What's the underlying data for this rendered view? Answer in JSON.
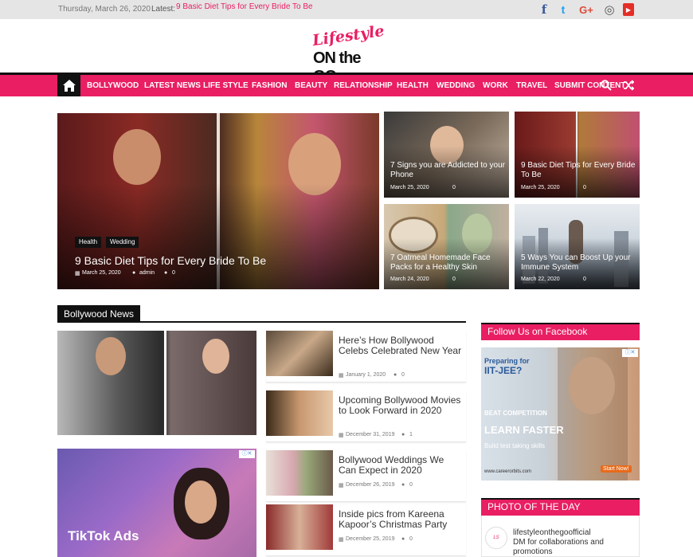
{
  "topbar": {
    "date": "Thursday, March 26, 2020",
    "latest_label": "Latest:",
    "latest_link": "9 Basic Diet Tips for Every Bride To Be"
  },
  "social": [
    {
      "name": "facebook-icon",
      "glyph": "f",
      "color": "#3b5998"
    },
    {
      "name": "twitter-icon",
      "glyph": "t",
      "color": "#1da1f2"
    },
    {
      "name": "google-plus-icon",
      "glyph": "G+",
      "color": "#dd4b39"
    },
    {
      "name": "instagram-icon",
      "glyph": "◎",
      "color": "#555555"
    },
    {
      "name": "youtube-icon",
      "glyph": "▶",
      "color": "#e52d27"
    }
  ],
  "logo": {
    "line1": "Lifestyle",
    "line2": "ON the GO"
  },
  "nav": {
    "items": [
      "BOLLYWOOD",
      "LATEST NEWS",
      "LIFE STYLE",
      "FASHION",
      "BEAUTY",
      "RELATIONSHIP",
      "HEALTH",
      "WEDDING",
      "WORK",
      "TRAVEL",
      "SUBMIT CONTENT"
    ]
  },
  "featured": {
    "tags": [
      "Health",
      "Wedding"
    ],
    "title": "9 Basic Diet Tips for Every Bride To Be",
    "date": "March 25, 2020",
    "author": "admin",
    "comments": "0"
  },
  "grid": [
    {
      "title": "7 Signs you are Addicted to your Phone",
      "date": "March 25, 2020",
      "comments": "0"
    },
    {
      "title": "9 Basic Diet Tips for Every Bride To Be",
      "date": "March 25, 2020",
      "comments": "0"
    },
    {
      "title": "7 Oatmeal Homemade Face Packs for a Healthy Skin",
      "date": "March 24, 2020",
      "comments": "0"
    },
    {
      "title": "5 Ways You can Boost Up your Immune System",
      "date": "March 22, 2020",
      "comments": "0"
    }
  ],
  "bollywood": {
    "heading": "Bollywood News",
    "items": [
      {
        "title": "Here’s How Bollywood Celebs Celebrated New Year",
        "date": "January 1, 2020",
        "comments": "0"
      },
      {
        "title": "Upcoming Bollywood Movies to Look Forward in 2020",
        "date": "December 31, 2019",
        "comments": "1"
      },
      {
        "title": "Bollywood Weddings We Can Expect in 2020",
        "date": "December 26, 2019",
        "comments": "0"
      },
      {
        "title": "Inside pics from Kareena Kapoor’s Christmas Party",
        "date": "December 25, 2019",
        "comments": "0"
      }
    ]
  },
  "ad_left": {
    "text": "TikTok Ads"
  },
  "sidebar": {
    "facebook_heading": "Follow Us on Facebook",
    "ad": {
      "line1": "Preparing for",
      "line2": "IIT-JEE?",
      "line3": "BEAT COMPETITION",
      "line4": "LEARN FASTER",
      "line5": "Build test taking skills",
      "url": "www.careerorbits.com",
      "cta": "Start Now!"
    },
    "photo_heading": "PHOTO OF THE DAY",
    "photo_account": "lifestyleonthegoofficial",
    "photo_desc": "DM for collaborations and promotions"
  }
}
